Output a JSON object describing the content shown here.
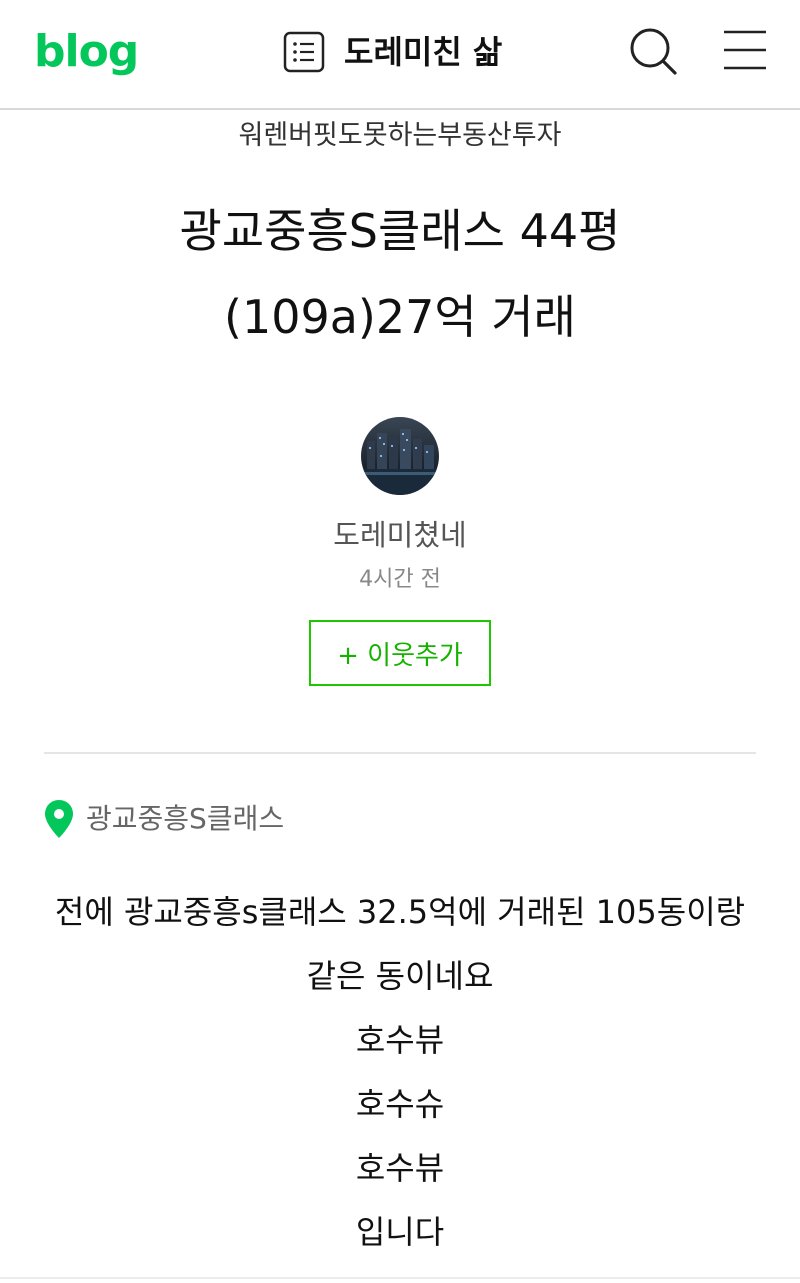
{
  "header": {
    "logo_text": "blog",
    "blog_name": "도레미친 삶",
    "icons": [
      "list-icon",
      "search-icon",
      "menu-icon"
    ]
  },
  "post": {
    "category": "워렌버핏도못하는부동산투자",
    "title_line1": "광교중흥S클래스 44평",
    "title_line2": "(109a)27억 거래",
    "author": "도레미쳤네",
    "time": "4시간 전",
    "add_neighbor_label": "+ 이웃추가",
    "place": "광교중흥S클래스",
    "paragraphs": [
      "전에 광교중흥s클래스 32.5억에 거래된 105동이랑",
      "같은 동이네요",
      "호수뷰",
      "호수슈",
      "호수뷰",
      "입니다"
    ]
  },
  "colors": {
    "brand_green": "#03c75a",
    "button_border": "#1ec800",
    "divider": "#e5e5e5"
  }
}
